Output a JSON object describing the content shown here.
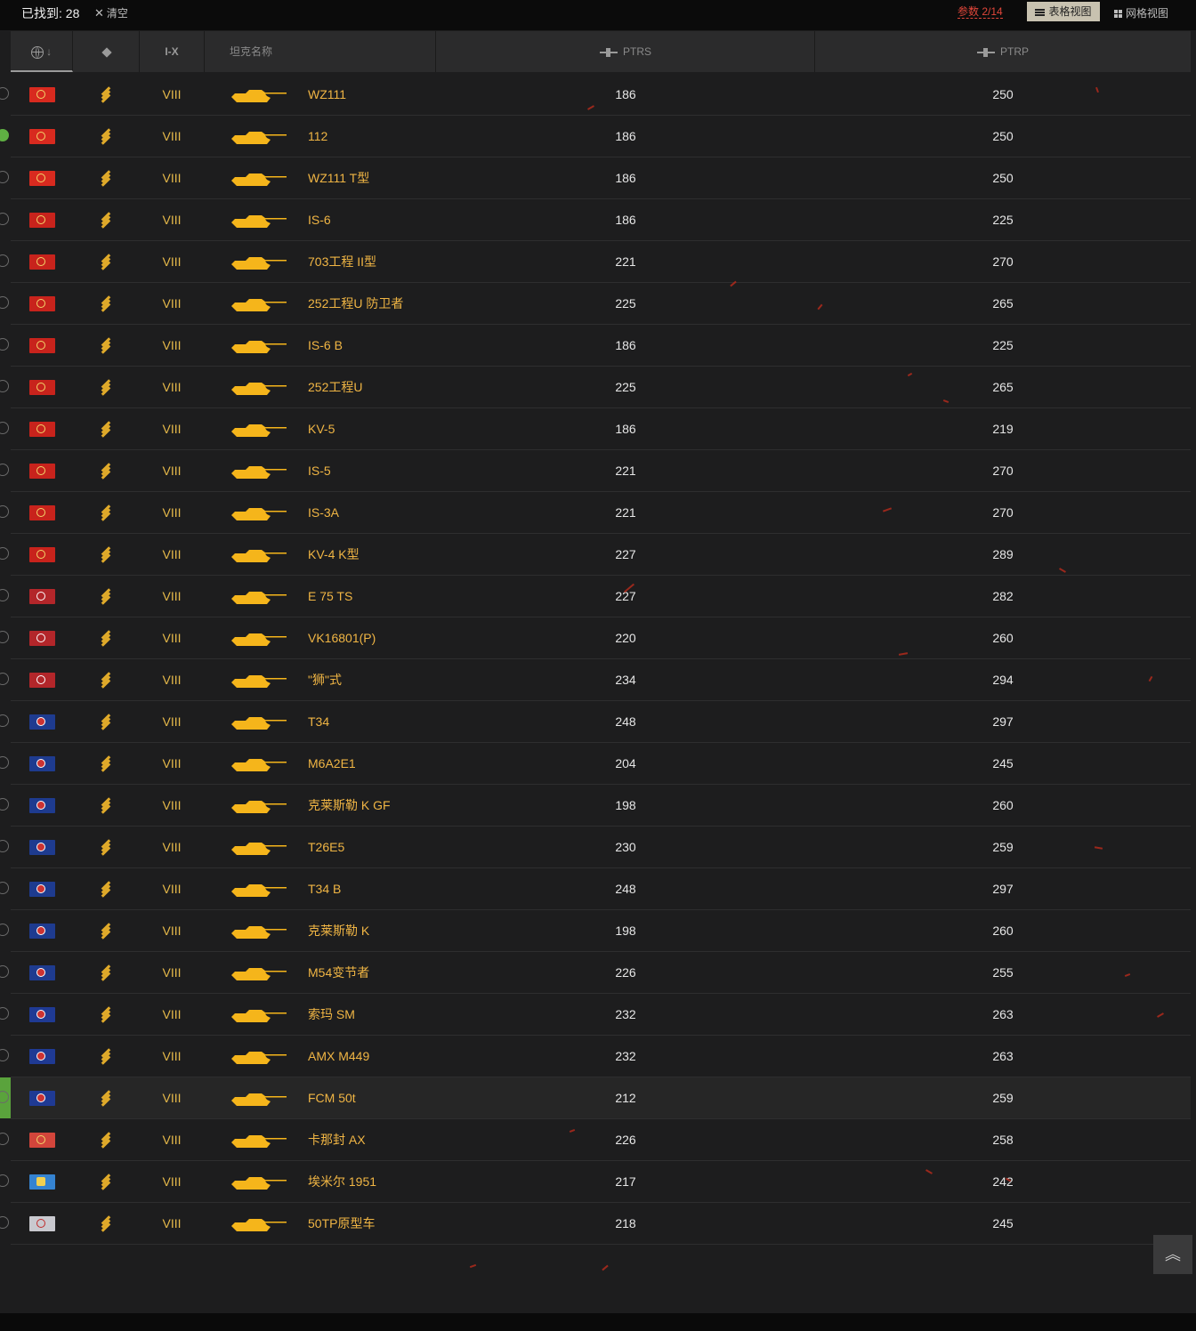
{
  "toolbar": {
    "found_label": "已找到: ",
    "found_count": "28",
    "clear_label": "清空",
    "params_label": "参数 2/14",
    "table_view_label": "表格视图",
    "grid_view_label": "网格视图"
  },
  "header": {
    "sort_arrow": "↓",
    "tier_col": "I-X",
    "name_col": "坦克名称",
    "ptrs_col": "PTRS",
    "ptrp_col": "PTRP"
  },
  "back_to_top_icon": "double-chevron-up-icon",
  "colors": {
    "accent": "#f0b544",
    "highlight": "#5aa33c",
    "params": "#e0463a"
  },
  "rows": [
    {
      "nation": "china",
      "tier": "VIII",
      "name": "WZ111",
      "ptrs": "186",
      "ptrp": "250"
    },
    {
      "nation": "china",
      "tier": "VIII",
      "name": "112",
      "ptrs": "186",
      "ptrp": "250",
      "checked": true
    },
    {
      "nation": "china",
      "tier": "VIII",
      "name": "WZ111 T型",
      "ptrs": "186",
      "ptrp": "250"
    },
    {
      "nation": "ussr",
      "tier": "VIII",
      "name": "IS-6",
      "ptrs": "186",
      "ptrp": "225"
    },
    {
      "nation": "ussr",
      "tier": "VIII",
      "name": "703工程 II型",
      "ptrs": "221",
      "ptrp": "270"
    },
    {
      "nation": "ussr",
      "tier": "VIII",
      "name": "252工程U 防卫者",
      "ptrs": "225",
      "ptrp": "265"
    },
    {
      "nation": "ussr",
      "tier": "VIII",
      "name": "IS-6 B",
      "ptrs": "186",
      "ptrp": "225"
    },
    {
      "nation": "ussr",
      "tier": "VIII",
      "name": "252工程U",
      "ptrs": "225",
      "ptrp": "265"
    },
    {
      "nation": "ussr",
      "tier": "VIII",
      "name": "KV-5",
      "ptrs": "186",
      "ptrp": "219"
    },
    {
      "nation": "ussr",
      "tier": "VIII",
      "name": "IS-5",
      "ptrs": "221",
      "ptrp": "270"
    },
    {
      "nation": "ussr",
      "tier": "VIII",
      "name": "IS-3A",
      "ptrs": "221",
      "ptrp": "270"
    },
    {
      "nation": "ussr",
      "tier": "VIII",
      "name": "KV-4 K型",
      "ptrs": "227",
      "ptrp": "289"
    },
    {
      "nation": "germany",
      "tier": "VIII",
      "name": "E 75 TS",
      "ptrs": "227",
      "ptrp": "282"
    },
    {
      "nation": "germany",
      "tier": "VIII",
      "name": "VK16801(P)",
      "ptrs": "220",
      "ptrp": "260"
    },
    {
      "nation": "germany",
      "tier": "VIII",
      "name": "\"狮\"式",
      "ptrs": "234",
      "ptrp": "294"
    },
    {
      "nation": "usa",
      "tier": "VIII",
      "name": "T34",
      "ptrs": "248",
      "ptrp": "297"
    },
    {
      "nation": "usa",
      "tier": "VIII",
      "name": "M6A2E1",
      "ptrs": "204",
      "ptrp": "245"
    },
    {
      "nation": "usa",
      "tier": "VIII",
      "name": "克莱斯勒 K GF",
      "ptrs": "198",
      "ptrp": "260"
    },
    {
      "nation": "usa",
      "tier": "VIII",
      "name": "T26E5",
      "ptrs": "230",
      "ptrp": "259"
    },
    {
      "nation": "usa",
      "tier": "VIII",
      "name": "T34 B",
      "ptrs": "248",
      "ptrp": "297"
    },
    {
      "nation": "usa",
      "tier": "VIII",
      "name": "克莱斯勒 K",
      "ptrs": "198",
      "ptrp": "260"
    },
    {
      "nation": "usa",
      "tier": "VIII",
      "name": "M54变节者",
      "ptrs": "226",
      "ptrp": "255"
    },
    {
      "nation": "france",
      "tier": "VIII",
      "name": "索玛 SM",
      "ptrs": "232",
      "ptrp": "263"
    },
    {
      "nation": "france",
      "tier": "VIII",
      "name": "AMX M449",
      "ptrs": "232",
      "ptrp": "263"
    },
    {
      "nation": "france",
      "tier": "VIII",
      "name": "FCM 50t",
      "ptrs": "212",
      "ptrp": "259",
      "highlighted": true
    },
    {
      "nation": "italy",
      "tier": "VIII",
      "name": "卡那封 AX",
      "ptrs": "226",
      "ptrp": "258"
    },
    {
      "nation": "sweden",
      "tier": "VIII",
      "name": "埃米尔 1951",
      "ptrs": "217",
      "ptrp": "242"
    },
    {
      "nation": "poland",
      "tier": "VIII",
      "name": "50TP原型车",
      "ptrs": "218",
      "ptrp": "245"
    }
  ]
}
